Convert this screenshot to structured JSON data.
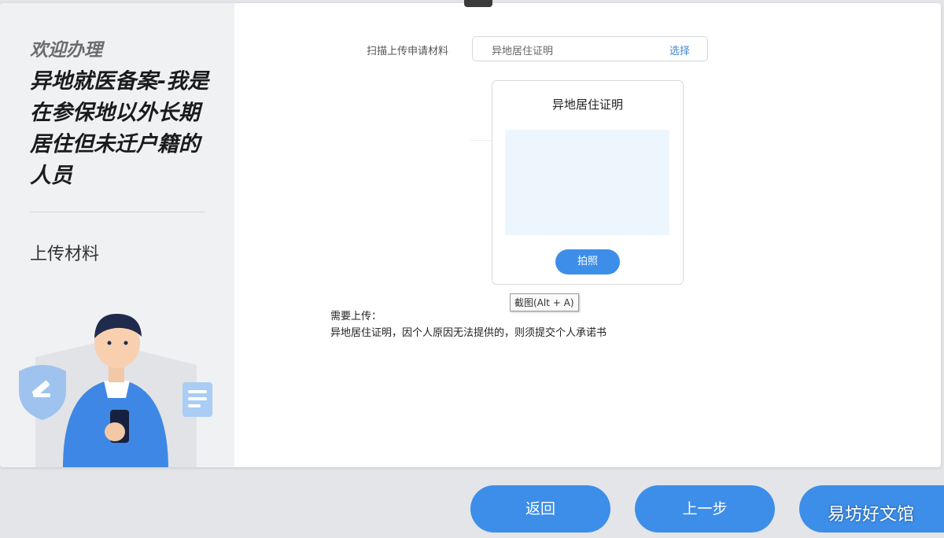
{
  "sidebar": {
    "welcome": "欢迎办理",
    "service_title": "异地就医备案-我是在参保地以外长期居住但未迁户籍的人员",
    "current_step": "上传材料"
  },
  "upload": {
    "label": "扫描上传申请材料",
    "select_value": "异地居住证明",
    "select_button": "选择",
    "card_title": "异地居住证明",
    "photo_button": "拍照",
    "tooltip": "截图(Alt + A)"
  },
  "requirements": {
    "title": "需要上传：",
    "text": "异地居住证明，因个人原因无法提供的，则须提交个人承诺书"
  },
  "footer": {
    "back": "返回",
    "prev": "上一步",
    "watermark": "易坊好文馆"
  },
  "colors": {
    "accent": "#3d8ee8",
    "sidebar_bg": "#f0f1f3",
    "preview_bg": "#eef6fd"
  }
}
